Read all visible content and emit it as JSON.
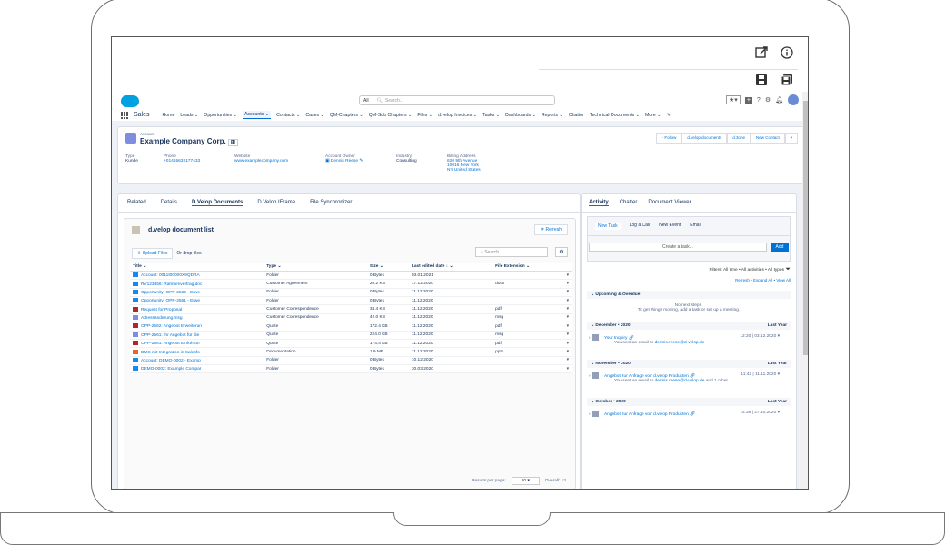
{
  "app": {
    "name": "Sales"
  },
  "search": {
    "scope": "All",
    "placeholder": "Search..."
  },
  "nav": {
    "items": [
      {
        "label": "Home",
        "dropdown": false,
        "active": false
      },
      {
        "label": "Leads",
        "dropdown": true,
        "active": false
      },
      {
        "label": "Opportunities",
        "dropdown": true,
        "active": false
      },
      {
        "label": "Accounts",
        "dropdown": true,
        "active": true
      },
      {
        "label": "Contacts",
        "dropdown": true,
        "active": false
      },
      {
        "label": "Cases",
        "dropdown": true,
        "active": false
      },
      {
        "label": "QM-Chapters",
        "dropdown": true,
        "active": false
      },
      {
        "label": "QM-Sub Chapters",
        "dropdown": true,
        "active": false
      },
      {
        "label": "Files",
        "dropdown": true,
        "active": false
      },
      {
        "label": "d.velop Invoices",
        "dropdown": true,
        "active": false
      },
      {
        "label": "Tasks",
        "dropdown": true,
        "active": false
      },
      {
        "label": "Dashboards",
        "dropdown": true,
        "active": false
      },
      {
        "label": "Reports",
        "dropdown": true,
        "active": false
      },
      {
        "label": "Chatter",
        "dropdown": false,
        "active": false
      },
      {
        "label": "Technical Documents",
        "dropdown": true,
        "active": false
      },
      {
        "label": "More",
        "dropdown": true,
        "active": false
      }
    ]
  },
  "account": {
    "type_label": "Account",
    "name": "Example Company Corp.",
    "buttons": [
      "+ Follow",
      "d.velop documents",
      "d.3one",
      "New Contact"
    ],
    "fields": {
      "type": {
        "label": "Type",
        "value": "Kunde"
      },
      "phone": {
        "label": "Phone",
        "value": "+01465632177433"
      },
      "website": {
        "label": "Website",
        "value": "www.examplecompany.com"
      },
      "owner": {
        "label": "Account Owner",
        "value": "Dennis Reese"
      },
      "industry": {
        "label": "Industry",
        "value": "Consulting"
      },
      "billing": {
        "label": "Billing Address",
        "lines": [
          "620 9th Avenue",
          "10016 New York",
          "NY United States"
        ]
      }
    }
  },
  "left_tabs": [
    {
      "label": "Related",
      "active": false
    },
    {
      "label": "Details",
      "active": false
    },
    {
      "label": "D.Velop Documents",
      "active": true
    },
    {
      "label": "D.Velop IFrame",
      "active": false
    },
    {
      "label": "File Synchronizer",
      "active": false
    }
  ],
  "doclist": {
    "title": "d.velop document list",
    "refresh": "Refresh",
    "upload": "Upload Files",
    "drop": "Or drop files",
    "search_placeholder": "Search",
    "columns": [
      "Title",
      "Type",
      "Size",
      "Last edited date",
      "File Extension"
    ],
    "rows": [
      {
        "title": "Account: 0011t00000X9QDRA",
        "type": "Folder",
        "size": "0 Bytes",
        "date": "03.01.2021",
        "ext": "",
        "color": "#1589ee"
      },
      {
        "title": "RV123456: Rahmenvertrag.doc",
        "type": "Customer Agreement",
        "size": "20.2 KB",
        "date": "17.12.2020",
        "ext": "docx",
        "color": "#1589ee"
      },
      {
        "title": "Opportunity: OPP-2562 - Erwe",
        "type": "Folder",
        "size": "0 Bytes",
        "date": "11.12.2020",
        "ext": "",
        "color": "#1589ee"
      },
      {
        "title": "Opportunity: OPP-2561 - Erwe",
        "type": "Folder",
        "size": "0 Bytes",
        "date": "11.12.2020",
        "ext": "",
        "color": "#1589ee"
      },
      {
        "title": "Request for Proposal",
        "type": "Customer Correspondence",
        "size": "34.4 KB",
        "date": "11.12.2020",
        "ext": "pdf",
        "color": "#b3262a"
      },
      {
        "title": "Adressänderung.msg",
        "type": "Customer Correspondence",
        "size": "42.0 KB",
        "date": "11.12.2020",
        "ext": "msg",
        "color": "#7f8de1"
      },
      {
        "title": "OPP-2562: Angebot Erweiterun",
        "type": "Quote",
        "size": "172.4 KB",
        "date": "11.12.2020",
        "ext": "pdf",
        "color": "#b3262a"
      },
      {
        "title": "OPP-2561: Ihr Angebot für die",
        "type": "Quote",
        "size": "224.0 KB",
        "date": "11.12.2020",
        "ext": "msg",
        "color": "#7f8de1"
      },
      {
        "title": "OPP-2561: Angebot Einführun",
        "type": "Quote",
        "size": "174.4 KB",
        "date": "11.12.2020",
        "ext": "pdf",
        "color": "#b3262a"
      },
      {
        "title": "DMS mit Integration in Salesfo",
        "type": "Documentation",
        "size": "1.9 MB",
        "date": "11.12.2020",
        "ext": "pptx",
        "color": "#e8652d"
      },
      {
        "title": "Account: DEMO-0002 - Examp",
        "type": "Folder",
        "size": "0 Bytes",
        "date": "10.12.2020",
        "ext": "",
        "color": "#1589ee"
      },
      {
        "title": "DEMO-0002: Example Compar",
        "type": "Folder",
        "size": "0 Bytes",
        "date": "30.03.2020",
        "ext": "",
        "color": "#1589ee"
      }
    ],
    "results_label": "Results per page:",
    "results_value": "20",
    "overall": "Overall: 12"
  },
  "activity": {
    "tabs": [
      {
        "label": "Activity",
        "active": true
      },
      {
        "label": "Chatter",
        "active": false
      },
      {
        "label": "Document Viewer",
        "active": false
      }
    ],
    "subtabs": [
      {
        "label": "New Task",
        "active": true
      },
      {
        "label": "Log a Call",
        "active": false
      },
      {
        "label": "New Event",
        "active": false
      },
      {
        "label": "Email",
        "active": false
      }
    ],
    "task_placeholder": "Create a task...",
    "add": "Add",
    "filters": "Filters: All time • All activities • All types",
    "links": "Refresh • Expand All • View All",
    "upcoming": "Upcoming & Overdue",
    "no_next": "No next steps.",
    "no_next_hint": "To get things moving, add a task or set up a meeting.",
    "sections": [
      {
        "label": "December • 2020",
        "right": "Last Year",
        "subject": "Your Inquiry",
        "date": "12:20 | 03.12.2020",
        "line": "You sent an email to",
        "email": "dennis.reese@d-velop.de",
        "suffix": ""
      },
      {
        "label": "November • 2020",
        "right": "Last Year",
        "subject": "Angebot zur Anfrage von d.velop Produkten",
        "date": "11:42 | 11.11.2020",
        "line": "You sent an email to",
        "email": "dennis.reese@d-velop.de",
        "suffix": "and 1 other"
      },
      {
        "label": "October • 2020",
        "right": "Last Year",
        "subject": "Angebot zur Anfrage von d.velop Produkten",
        "date": "14:36 | 27.10.2020",
        "line": "",
        "email": "",
        "suffix": ""
      }
    ]
  }
}
